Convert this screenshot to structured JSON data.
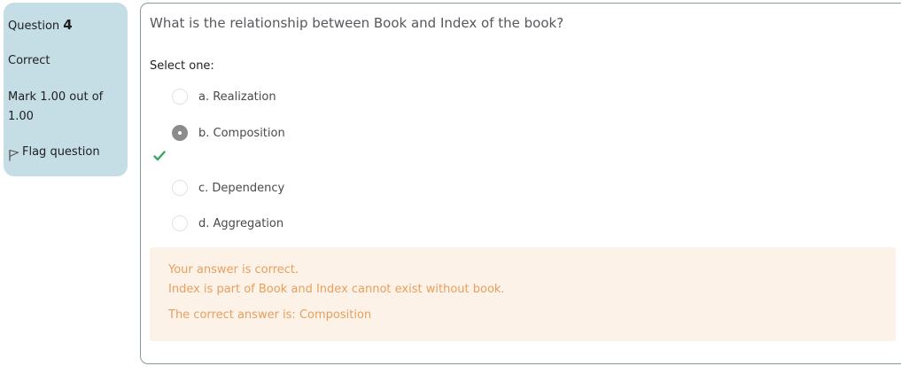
{
  "info": {
    "question_label": "Question",
    "question_number": "4",
    "state": "Correct",
    "grade": "Mark 1.00 out of 1.00",
    "flag_label": "Flag question"
  },
  "question": {
    "text": "What is the relationship between Book and Index of the book?",
    "prompt": "Select one:",
    "options": [
      {
        "label": "a. Realization",
        "selected": false
      },
      {
        "label": "b. Composition",
        "selected": true
      },
      {
        "label": "c. Dependency",
        "selected": false
      },
      {
        "label": "d. Aggregation",
        "selected": false
      }
    ]
  },
  "feedback": {
    "status": "Your answer is correct.",
    "explanation": "Index is part of Book and Index cannot exist without book.",
    "correct_answer": "The correct answer is: Composition"
  },
  "colors": {
    "info_background": "#c5dde4",
    "feedback_background": "#fdf2e8",
    "feedback_text": "#e6a05f",
    "correct_check": "#3aa660"
  }
}
